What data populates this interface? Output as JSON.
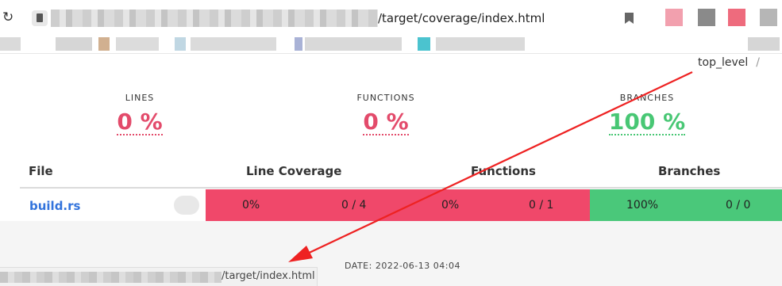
{
  "browser": {
    "url_suffix": "/target/coverage/index.html",
    "reload_icon": "reload-icon",
    "bookmark_icon": "bookmark-icon",
    "extension_colors": [
      "#f2a0ae",
      "#8a8a8a",
      "#ee6b7d",
      "#b6b6b6"
    ]
  },
  "bookmarks_bar": {
    "items": [
      {
        "color": "#d3d3d3"
      },
      {
        "color": "#cfcfcf"
      },
      {
        "color": "#c9a27c"
      },
      {
        "color": "#d6d6d6"
      },
      {
        "color": "#b5d0de"
      },
      {
        "color": "#d5d5d5"
      },
      {
        "color": "#9aa4cf"
      },
      {
        "color": "#d2d2d2"
      },
      {
        "color": "#2bb8c7"
      },
      {
        "color": "#d4d4d4"
      },
      {
        "color": "#cfcfcf"
      }
    ]
  },
  "breadcrumb": {
    "current": "top_level",
    "separator": "/"
  },
  "summary": [
    {
      "label": "LINES",
      "value": "0 %",
      "status": "red"
    },
    {
      "label": "FUNCTIONS",
      "value": "0 %",
      "status": "red"
    },
    {
      "label": "BRANCHES",
      "value": "100 %",
      "status": "green"
    }
  ],
  "table": {
    "headers": {
      "file": "File",
      "line": "Line Coverage",
      "functions": "Functions",
      "branches": "Branches"
    },
    "rows": [
      {
        "file": "build.rs",
        "line_percent": "0%",
        "line_ratio": "0 / 4",
        "fn_percent": "0%",
        "fn_ratio": "0 / 1",
        "branch_percent": "100%",
        "branch_ratio": "0 / 0"
      }
    ]
  },
  "footer": {
    "date": "DATE: 2022-06-13 04:04"
  },
  "status_bar": {
    "url_suffix": "/target/index.html"
  },
  "colors": {
    "red": "#f0486a",
    "green": "#4ac87a",
    "arrow": "#ee2222"
  }
}
